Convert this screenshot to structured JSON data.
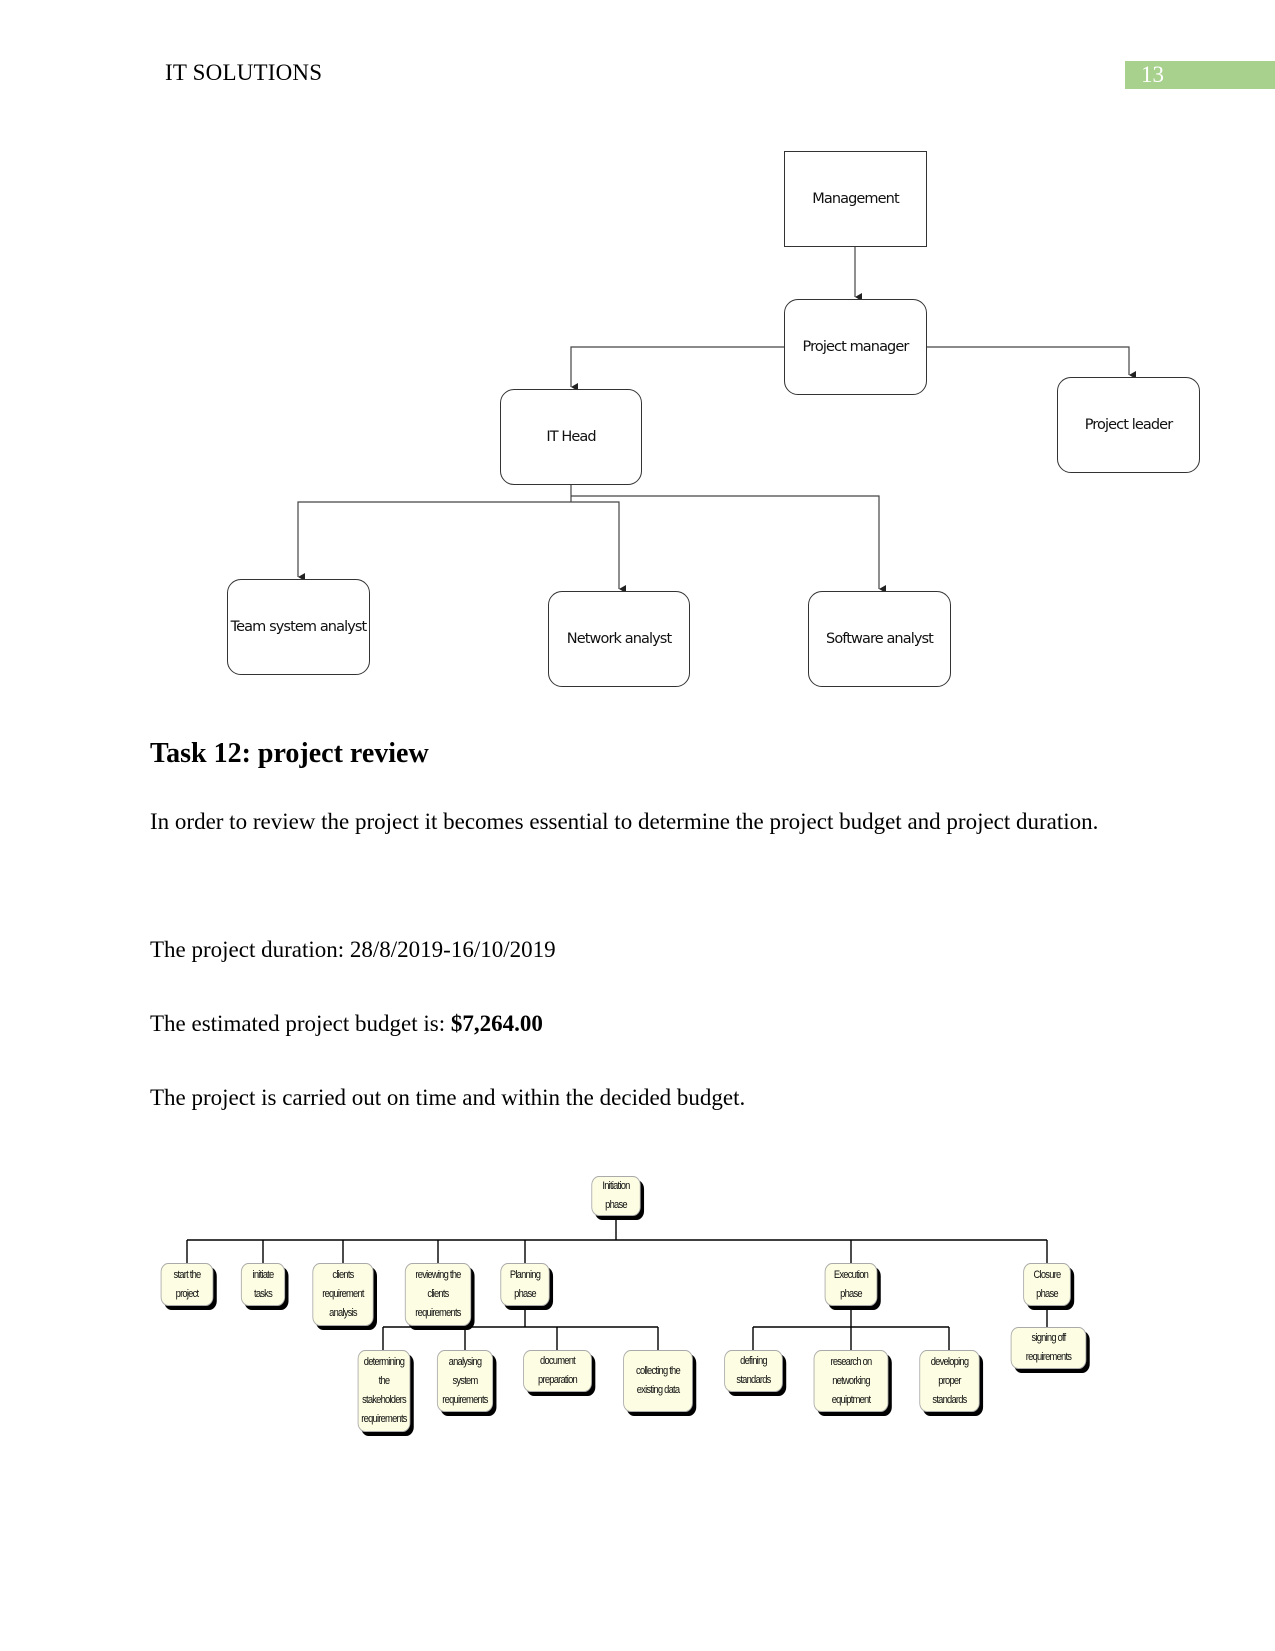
{
  "header": {
    "running_title": "IT SOLUTIONS",
    "page_number": "13",
    "page_bar_color": "#a9d18e"
  },
  "org_chart": {
    "nodes": {
      "management": "Management",
      "project_manager": "Project manager",
      "it_head": "IT Head",
      "project_leader": "Project leader",
      "team_system_analyst": "Team system analyst",
      "network_analyst": "Network analyst",
      "software_analyst": "Software analyst"
    },
    "edges": [
      [
        "management",
        "project_manager"
      ],
      [
        "project_manager",
        "it_head"
      ],
      [
        "project_manager",
        "project_leader"
      ],
      [
        "it_head",
        "team_system_analyst"
      ],
      [
        "it_head",
        "network_analyst"
      ],
      [
        "it_head",
        "software_analyst"
      ]
    ]
  },
  "section": {
    "heading": "Task 12: project review",
    "intro": "In order to review the project it becomes essential to determine the project budget and project duration.",
    "duration_line": "The project duration: 28/8/2019-16/10/2019",
    "budget_prefix": "The estimated project budget is: ",
    "budget_value": "$7,264.00",
    "conclusion": "The project is carried out on time and within the decided budget."
  },
  "wbs": {
    "box_fill": "#fdfde3",
    "root": "Initiation phase",
    "level1": [
      "start the project",
      "initiate tasks",
      "clients requirement analysis",
      "reviewing the clients requirements",
      "Planning phase",
      "Execution phase",
      "Closure phase"
    ],
    "planning_children": [
      "determining the stakeholders requirements",
      "analysing system requirements",
      "document preparation",
      "collecting the existing data"
    ],
    "execution_children": [
      "defining standards",
      "research on networking equiptment",
      "developing proper standards"
    ],
    "closure_children": [
      "signing off requirements"
    ]
  }
}
